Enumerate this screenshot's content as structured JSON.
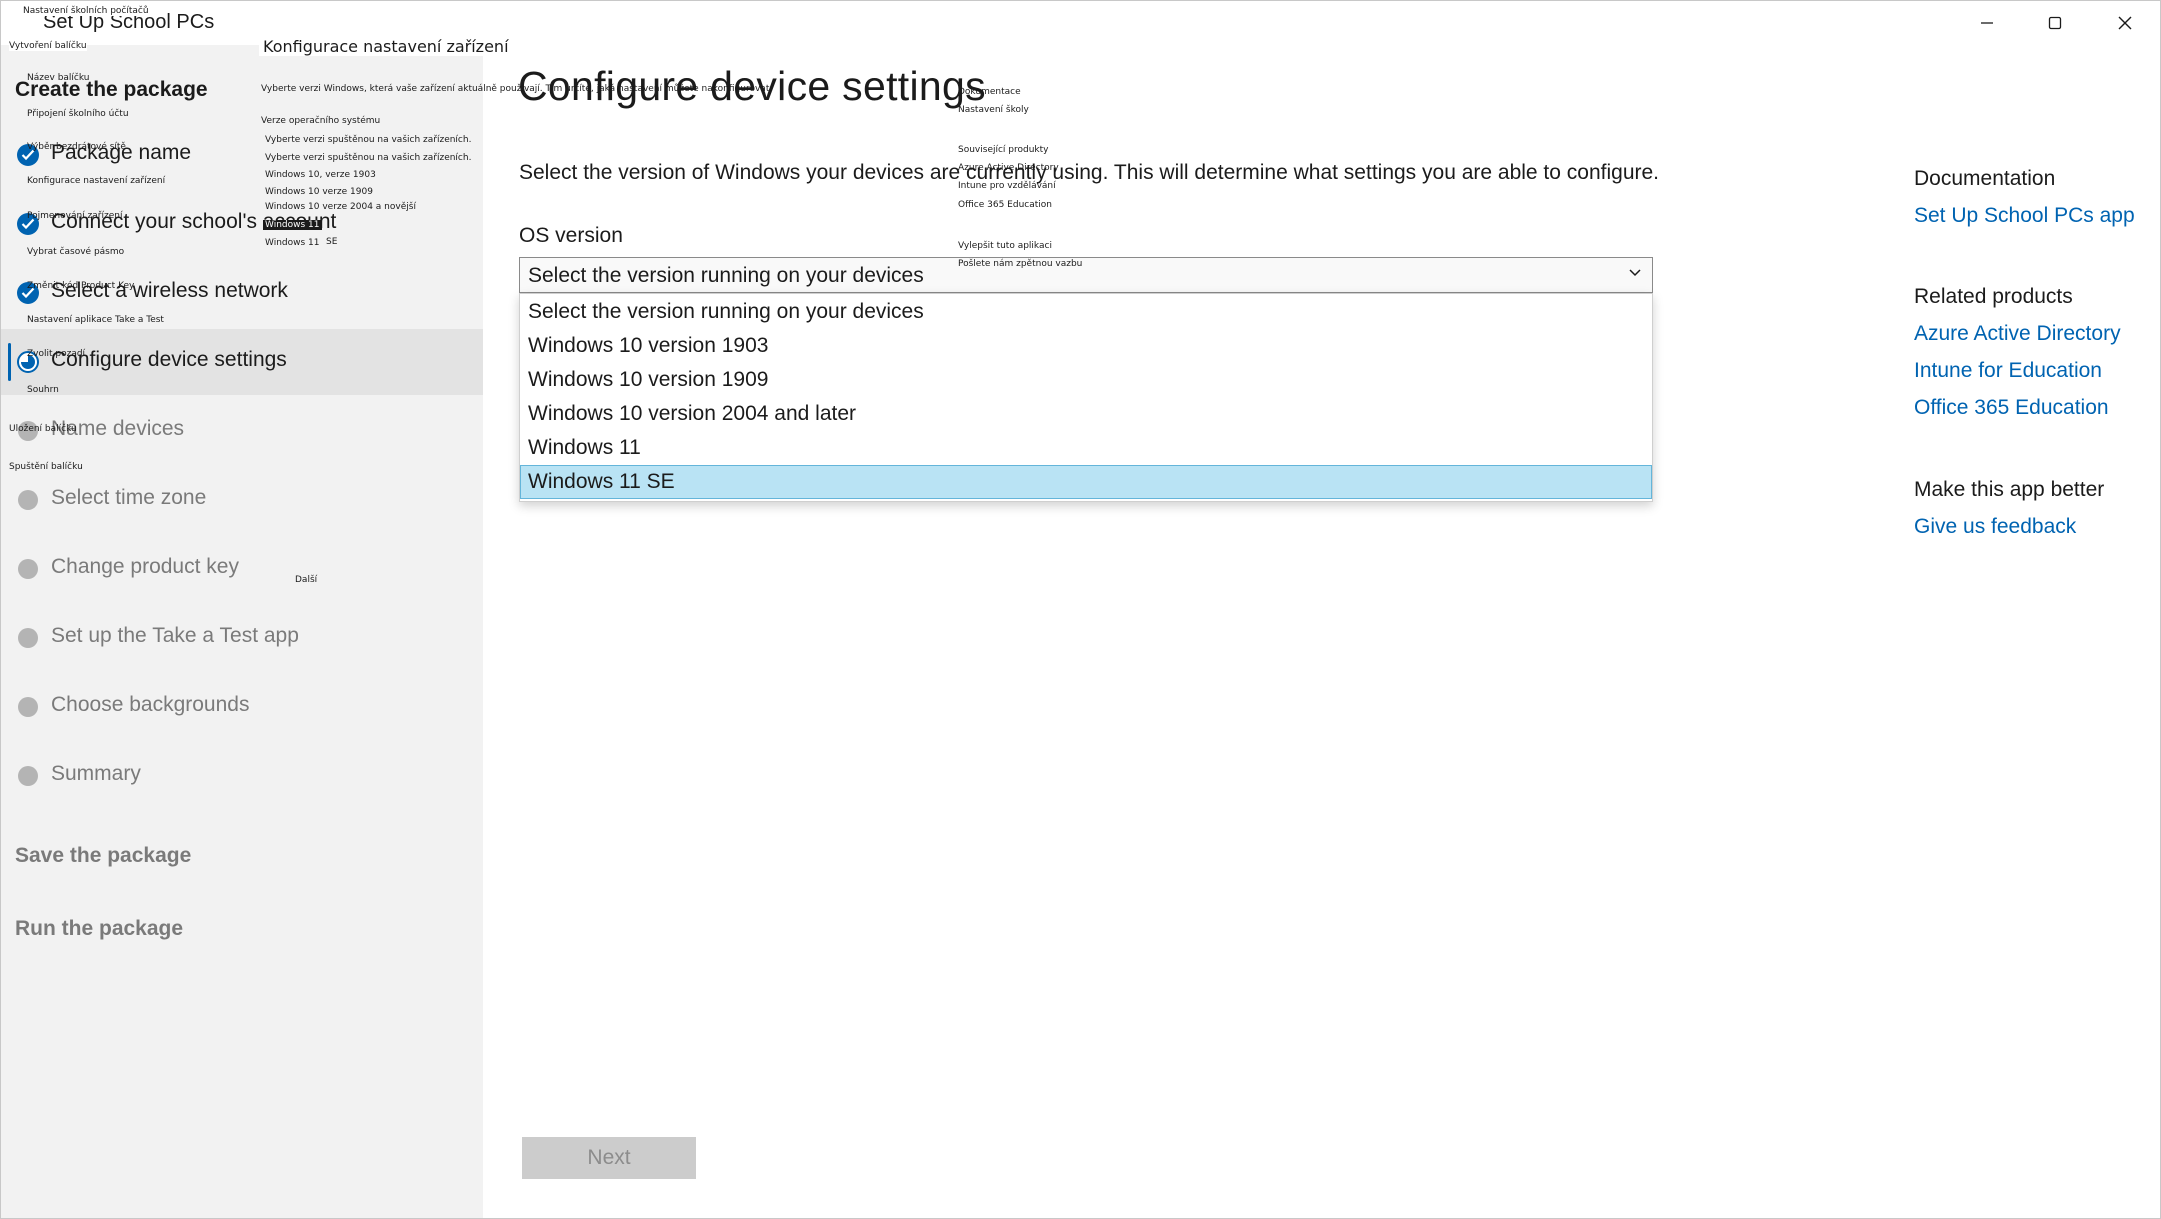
{
  "window": {
    "title": "Set Up School PCs",
    "minimize_glyph": "—",
    "maximize_glyph": "☐",
    "close_glyph": "✕"
  },
  "sidebar": {
    "sections": {
      "create": "Create the package",
      "save": "Save the package",
      "run": "Run the package"
    },
    "steps": [
      {
        "label": "Package name",
        "state": "done"
      },
      {
        "label": "Connect your school's account",
        "state": "done"
      },
      {
        "label": "Select a wireless network",
        "state": "done"
      },
      {
        "label": "Configure device settings",
        "state": "current"
      },
      {
        "label": "Name devices",
        "state": "todo"
      },
      {
        "label": "Select time zone",
        "state": "todo"
      },
      {
        "label": "Change product key",
        "state": "todo"
      },
      {
        "label": "Set up the Take a Test app",
        "state": "todo"
      },
      {
        "label": "Choose backgrounds",
        "state": "todo"
      },
      {
        "label": "Summary",
        "state": "todo"
      }
    ]
  },
  "main": {
    "heading": "Configure device settings",
    "description": "Select the version of Windows your devices are currently using. This will determine what settings you are able to configure.",
    "os_label": "OS version",
    "os_select_value": "Select the version running on your devices",
    "options": [
      "Select the version running on your devices",
      "Windows 10 version 1903",
      "Windows 10 version 1909",
      "Windows 10 version 2004 and later",
      "Windows 11",
      "Windows 11 SE"
    ],
    "selected_option": "Windows 11 SE",
    "next_label": "Next"
  },
  "right_pane": {
    "documentation_heading": "Documentation",
    "documentation_link": "Set Up School PCs app",
    "related_heading": "Related products",
    "related_links": [
      "Azure Active Directory",
      "Intune for Education",
      "Office 365 Education"
    ],
    "better_heading": "Make this app better",
    "feedback_link": "Give us feedback"
  },
  "localization_overlay": {
    "app_title": "Nastavení školních počítačů",
    "create_section": "Vytvoření balíčku",
    "step_package_name": "Název balíčku",
    "step_account": "Připojení školního účtu",
    "step_wireless": "Výběr bezdrátové sítě",
    "step_config": "Konfigurace nastavení zařízení",
    "step_name_devices": "Pojmenování zařízení",
    "step_time_zone": "Vybrat časové pásmo",
    "step_product_key": "Změnit kód Product Key",
    "step_take_test": "Nastavení aplikace Take a Test",
    "step_backgrounds": "Zvolit pozadí",
    "step_summary": "Souhrn",
    "save_section": "Uložení balíčku",
    "run_section": "Spuštění balíčku",
    "heading": "Konfigurace nastavení zařízení",
    "description": "Vyberte verzi Windows, která vaše zařízení aktuálně používají. Tím určíte, jaká nastavení můžete nakonfigurovat.",
    "os_label": "Verze operačního systému",
    "select_value": "Vyberte verzi spuštěnou na vašich zařízeních.",
    "option_0": "Vyberte verzi spuštěnou na vašich zařízeních.",
    "option_1": "Windows 10, verze 1903",
    "option_2": "Windows 10 verze 1909",
    "option_3": "Windows 10 verze 2004 a novější",
    "option_4": "Windows 11",
    "option_5": "Windows 11",
    "option_5_suffix": "SE",
    "next": "Další",
    "documentation": "Dokumentace",
    "doc_link": "Nastavení školy",
    "related": "Související produkty",
    "rel_1": "Azure Active Directory",
    "rel_2": "Intune pro vzdělávání",
    "rel_3": "Office 365 Education",
    "better": "Vylepšit tuto aplikaci",
    "feedback": "Pošlete nám zpětnou vazbu"
  },
  "colors": {
    "accent": "#0063b1",
    "sidebar_bg": "#f2f2f2",
    "selected_option_bg": "#b9e3f4",
    "disabled_text": "#7a7a7a"
  }
}
